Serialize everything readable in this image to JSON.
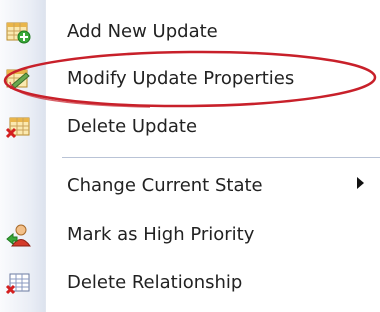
{
  "context_menu": {
    "items": [
      {
        "label": "Add New Update",
        "icon": "add-grid-icon"
      },
      {
        "label": "Modify Update Properties",
        "icon": "edit-pencil-icon"
      },
      {
        "label": "Delete Update",
        "icon": "delete-grid-icon"
      },
      {
        "label": "Change Current State",
        "icon": "",
        "submenu": true
      },
      {
        "label": "Mark as High Priority",
        "icon": "user-priority-icon"
      },
      {
        "label": "Delete Relationship",
        "icon": "delete-relationship-icon"
      }
    ],
    "highlighted_item": "Modify Update Properties",
    "colors": {
      "annotation_ellipse": "#c8202a",
      "gutter": "#e9edf5",
      "separator": "#b9c3d6"
    }
  }
}
